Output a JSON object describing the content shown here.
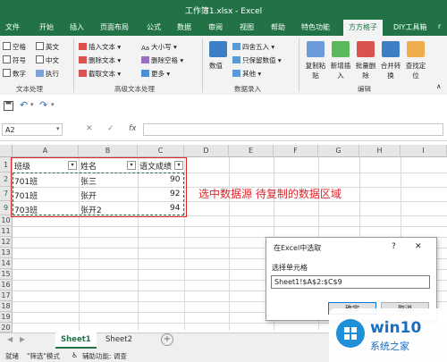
{
  "window": {
    "title": "工作簿1.xlsx  -  Excel"
  },
  "ribbon_tabs": [
    "文件",
    "开始",
    "插入",
    "页面布局",
    "公式",
    "数据",
    "审阅",
    "视图",
    "帮助",
    "特色功能",
    "方方格子",
    "DIY工具箱",
    "r"
  ],
  "active_tab": "方方格子",
  "ribbon": {
    "text_group": {
      "checks": [
        "空格",
        "英文",
        "符号",
        "中文",
        "数字",
        "执行"
      ],
      "label": "文本处理"
    },
    "advanced_text": {
      "items": [
        "插入文本",
        "删除文本",
        "截取文本",
        "大小写",
        "删除空格",
        "更多"
      ],
      "label": "高级文本处理"
    },
    "numeric": {
      "big": "数值",
      "items": [
        "四舍五入",
        "只保留数值",
        "其他"
      ],
      "label": "数据录入"
    },
    "edit": {
      "items": [
        "复制粘贴",
        "新增插入",
        "批量删除",
        "合并转换",
        "查找定位"
      ],
      "label": "编辑"
    }
  },
  "formula_bar": {
    "name_box": "A2",
    "cancel": "✕",
    "enter": "✓",
    "fx": "fx",
    "value": ""
  },
  "columns": [
    "A",
    "B",
    "C",
    "D",
    "E",
    "F",
    "G",
    "H",
    "I"
  ],
  "rows": [
    "1",
    "2",
    "7",
    "9",
    "10",
    "11",
    "12",
    "13",
    "14",
    "15",
    "16",
    "17",
    "18",
    "19",
    "20",
    "21",
    "22"
  ],
  "table": {
    "headers": [
      "班级",
      "姓名",
      "语文成绩"
    ],
    "data": [
      [
        "701班",
        "张三",
        "90"
      ],
      [
        "701班",
        "张开",
        "92"
      ],
      [
        "703班",
        "张开2",
        "94"
      ]
    ]
  },
  "annotation": "选中数据源  待复制的数据区域",
  "sheets": [
    "Sheet1",
    "Sheet2"
  ],
  "active_sheet": "Sheet1",
  "status": {
    "text": "就绪",
    "filter_mode": "\"筛选\"模式",
    "accessibility": "辅助功能: 调查"
  },
  "dialog": {
    "title": "在Excel中选取",
    "help": "?",
    "close": "✕",
    "label": "选择单元格",
    "value": "Sheet1!$A$2:$C$9",
    "ok": "确定",
    "cancel": "取消"
  },
  "watermark": {
    "brand": "win10",
    "subtitle": "系统之家"
  },
  "colors": {
    "excel_green": "#217346",
    "annotation_red": "#e0262b",
    "select_border": "#217346"
  }
}
